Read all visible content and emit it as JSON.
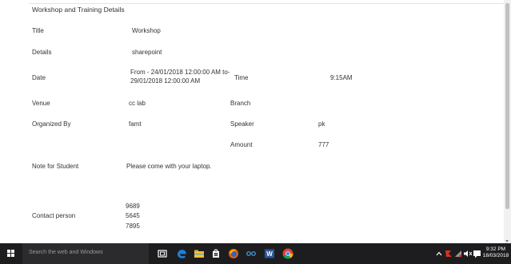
{
  "section_title": "Workshop and Training Details",
  "rows": {
    "title": {
      "label": "Title",
      "value": "Workshop"
    },
    "details": {
      "label": "Details",
      "value": "sharepoint"
    },
    "date": {
      "label": "Date",
      "value_line1": "From - 24/01/2018 12:00:00 AM  to-",
      "value_line2": "29/01/2018 12:00:00 AM"
    },
    "time": {
      "label": "Time",
      "value": "9:15AM"
    },
    "venue": {
      "label": "Venue",
      "value": "cc lab"
    },
    "branch": {
      "label": "Branch",
      "value": ""
    },
    "organized_by": {
      "label": "Organized By",
      "value": "famt"
    },
    "speaker": {
      "label": "Speaker",
      "value": "pk"
    },
    "amount": {
      "label": "Amount",
      "value": "777"
    },
    "note_for_student": {
      "label": "Note for Student",
      "value": "Please come with your laptop."
    },
    "contact_person": {
      "label": "Contact person",
      "numbers": [
        "9689",
        "5645",
        "7895"
      ]
    }
  },
  "taskbar": {
    "search_placeholder": "Search the web and Windows",
    "icons": [
      "windows-logo-icon",
      "task-view-icon",
      "edge-icon",
      "file-explorer-icon",
      "store-icon",
      "firefox-icon",
      "chat-icon",
      "word-icon",
      "chrome-icon"
    ],
    "tray_icons": [
      "chevron-up-icon",
      "antivirus-icon",
      "network-icon",
      "volume-icon",
      "notification-icon"
    ],
    "time": "9:32 PM",
    "date": "18/03/2018"
  },
  "colors": {
    "taskbar": "#1d1d1f",
    "text": "#333333",
    "edge_blue": "#1e7fd6",
    "word_blue": "#2b579a"
  }
}
